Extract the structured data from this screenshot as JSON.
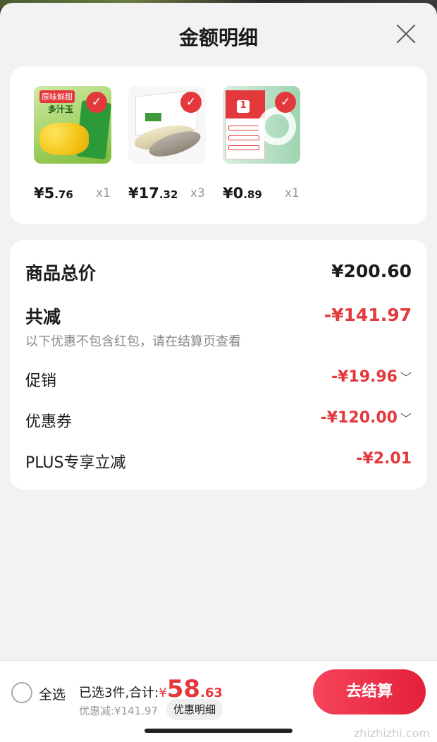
{
  "header": {
    "title": "金额明细"
  },
  "products": [
    {
      "price_int": "¥5",
      "price_dec": ".76",
      "qty": "x1",
      "img_text": [
        "原味鲜甜",
        "多汁玉"
      ]
    },
    {
      "price_int": "¥17",
      "price_dec": ".32",
      "qty": "x3"
    },
    {
      "price_int": "¥0",
      "price_dec": ".89",
      "qty": "x1",
      "img_text": [
        "1"
      ]
    }
  ],
  "summary": {
    "total_label": "商品总价",
    "total_value": "¥200.60",
    "reduce_label": "共减",
    "reduce_value": "-¥141.97",
    "note": "以下优惠不包含红包，请在结算页查看",
    "promo_label": "促销",
    "promo_value": "-¥19.96",
    "coupon_label": "优惠券",
    "coupon_value": "-¥120.00",
    "plus_label": "PLUS专享立减",
    "plus_value": "-¥2.01",
    "chevron": "﹀"
  },
  "bottom": {
    "select_all": "全选",
    "selected_text": "已选3件,合计:",
    "yen": "¥",
    "amount_int": "58",
    "amount_dec": ".63",
    "discount_text": "优惠减:¥141.97",
    "detail_chip": "优惠明细",
    "checkout_label": "去结算"
  },
  "watermark": "zhizhizhi.com",
  "colors": {
    "accent": "#e4393c",
    "background": "#f2f2f2",
    "card": "#ffffff"
  }
}
